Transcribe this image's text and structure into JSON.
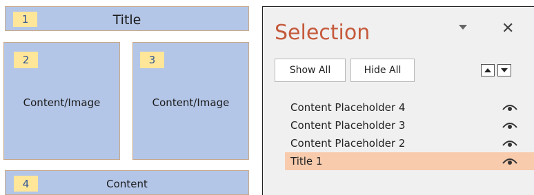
{
  "slide_layout": {
    "title_box": {
      "number": "1",
      "label": "Title"
    },
    "content_left": {
      "number": "2",
      "label": "Content/Image"
    },
    "content_right": {
      "number": "3",
      "label": "Content/Image"
    },
    "content_bottom": {
      "number": "4",
      "label": "Content"
    }
  },
  "selection_pane": {
    "title": "Selection",
    "menu_icon": "triangle-down-icon",
    "close_icon": "close-icon",
    "close_glyph": "✕",
    "show_all_label": "Show All",
    "hide_all_label": "Hide All",
    "move_up_icon": "bring-forward-icon",
    "move_down_icon": "send-backward-icon",
    "items": [
      {
        "label": "Content Placeholder 4",
        "visibility_icon": "eye-icon",
        "selected": false
      },
      {
        "label": "Content Placeholder 3",
        "visibility_icon": "eye-icon",
        "selected": false
      },
      {
        "label": "Content Placeholder 2",
        "visibility_icon": "eye-icon",
        "selected": false
      },
      {
        "label": "Title 1",
        "visibility_icon": "eye-icon",
        "selected": true
      }
    ]
  },
  "colors": {
    "placeholder_fill": "#b4c6e7",
    "number_badge": "#ffe699",
    "pane_title": "#c55a3c",
    "selected_row": "#f8cbad"
  }
}
